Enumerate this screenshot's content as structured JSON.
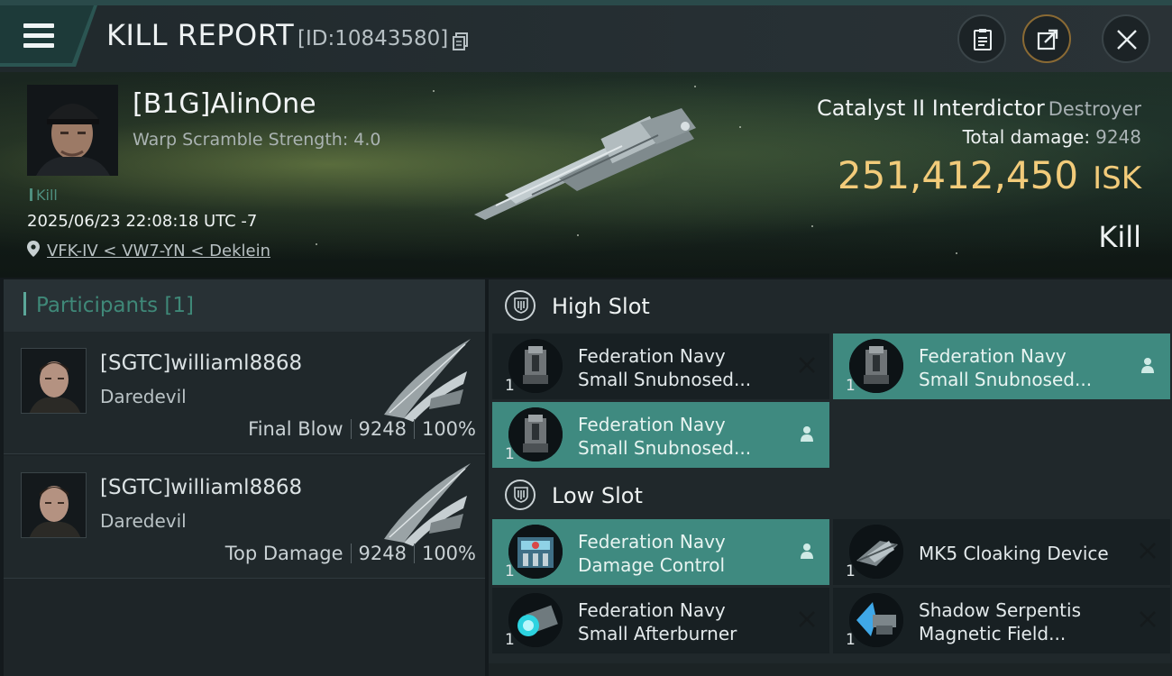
{
  "header": {
    "title": "KILL REPORT",
    "report_id": "[ID:10843580]",
    "icons": [
      "menu-icon",
      "copy-icon",
      "clipboard-icon",
      "share-icon",
      "close-icon"
    ]
  },
  "victim": {
    "name": "[B1G]AlinOne",
    "subtitle": "Warp Scramble Strength: 4.0",
    "tag": "Kill",
    "datetime": "2025/06/23 22:08:18 UTC -7",
    "location": "VFK-IV < VW7-YN < Deklein"
  },
  "ship": {
    "name": "Catalyst II Interdictor",
    "class": "Destroyer",
    "total_damage_label": "Total damage:",
    "total_damage": "9248",
    "isk_value": "251,412,450",
    "isk_unit": "ISK",
    "result": "Kill"
  },
  "participants": {
    "title": "Participants",
    "count": "[1]",
    "rows": [
      {
        "name": "[SGTC]williaml8868",
        "ship": "Daredevil",
        "role": "Final Blow",
        "damage": "9248",
        "percent": "100%"
      },
      {
        "name": "[SGTC]williaml8868",
        "ship": "Daredevil",
        "role": "Top Damage",
        "damage": "9248",
        "percent": "100%"
      }
    ]
  },
  "slots": {
    "high": {
      "label": "High Slot",
      "modules": [
        {
          "line1": "Federation Navy",
          "line2": "Small Snubnosed...",
          "qty": "1",
          "status": "destroyed"
        },
        {
          "line1": "Federation Navy",
          "line2": "Small Snubnosed...",
          "qty": "1",
          "status": "dropped"
        },
        {
          "line1": "Federation Navy",
          "line2": "Small Snubnosed...",
          "qty": "1",
          "status": "dropped"
        }
      ]
    },
    "low": {
      "label": "Low Slot",
      "modules": [
        {
          "line1": "Federation Navy",
          "line2": "Damage Control",
          "qty": "1",
          "status": "dropped"
        },
        {
          "line1": "MK5 Cloaking Device",
          "line2": "",
          "qty": "1",
          "status": "destroyed"
        },
        {
          "line1": "Federation Navy",
          "line2": "Small Afterburner",
          "qty": "1",
          "status": "destroyed"
        },
        {
          "line1": "Shadow Serpentis",
          "line2": "Magnetic Field...",
          "qty": "1",
          "status": "destroyed"
        }
      ]
    }
  },
  "colors": {
    "accent_teal": "#3f8a80",
    "isk_gold": "#f2cb7a",
    "panel": "#1e2528"
  }
}
